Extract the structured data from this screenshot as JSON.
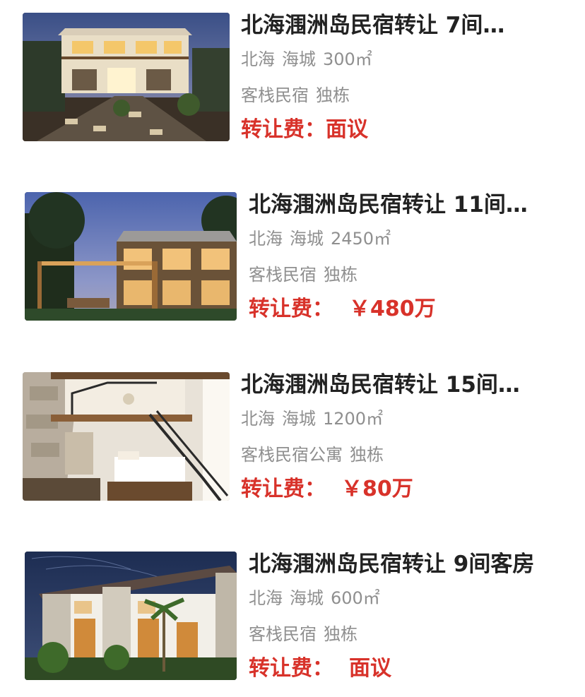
{
  "listings": [
    {
      "title": "北海涠洲岛民宿转让 7间…",
      "city": "北海",
      "district": "海城",
      "area": "300㎡",
      "tags": [
        "客栈民宿",
        "独栋"
      ],
      "price_label": "转让费：",
      "price_value": "面议"
    },
    {
      "title": "北海涠洲岛民宿转让 11间…",
      "city": "北海",
      "district": "海城",
      "area": "2450㎡",
      "tags": [
        "客栈民宿",
        "独栋"
      ],
      "price_label": "转让费：",
      "price_value": "￥480万"
    },
    {
      "title": "北海涠洲岛民宿转让 15间…",
      "city": "北海",
      "district": "海城",
      "area": "1200㎡",
      "tags": [
        "客栈民宿公寓",
        "独栋"
      ],
      "price_label": "转让费：",
      "price_value": "￥80万"
    },
    {
      "title": "北海涠洲岛民宿转让 9间客房",
      "city": "北海",
      "district": "海城",
      "area": "600㎡",
      "tags": [
        "客栈民宿",
        "独栋"
      ],
      "price_label": "转让费：",
      "price_value": "面议"
    }
  ],
  "colors": {
    "title": "#222222",
    "meta": "#8f8f8f",
    "price": "#d8322a"
  }
}
